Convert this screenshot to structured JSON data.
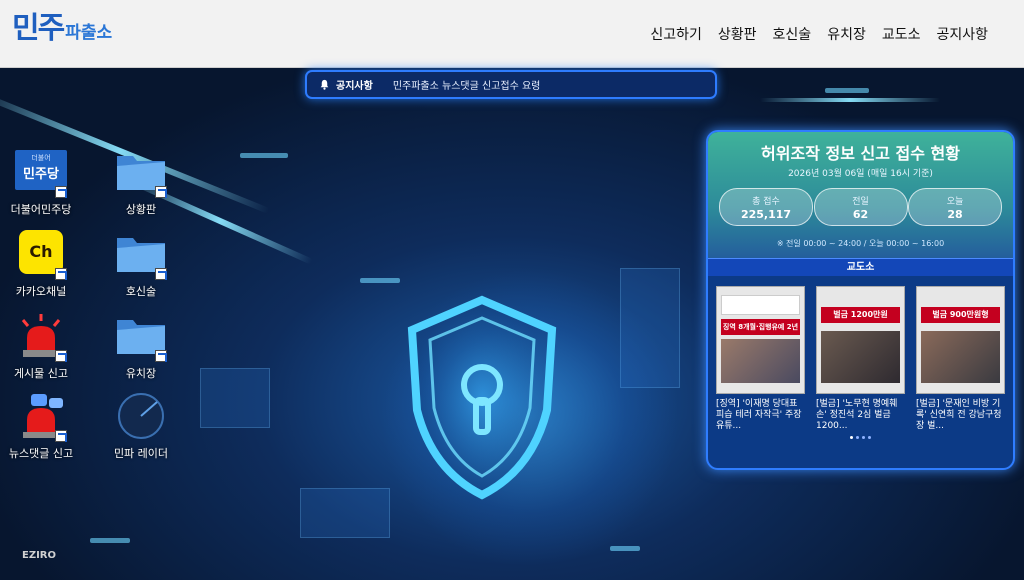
{
  "header": {
    "logo_main": "민주",
    "logo_sub": "파출소",
    "nav": [
      "신고하기",
      "상황판",
      "호신술",
      "유치장",
      "교도소",
      "공지사항"
    ]
  },
  "notice": {
    "label": "공지사항",
    "text": "민주파출소 뉴스댓글 신고접수 요령"
  },
  "desktop_icons": [
    {
      "label": "더불어민주당",
      "badge": "민주당",
      "badge_small": "더불어"
    },
    {
      "label": "상황판"
    },
    {
      "label": "카카오채널",
      "badge": "Ch"
    },
    {
      "label": "호신술"
    },
    {
      "label": "게시물 신고"
    },
    {
      "label": "유치장"
    },
    {
      "label": "뉴스댓글 신고"
    },
    {
      "label": "민파 레이더"
    }
  ],
  "widget": {
    "title": "허위조작 정보 신고 접수 현황",
    "date": "2026년 03월 06일 (매일 16시 기준)",
    "stats": [
      {
        "label": "총 접수",
        "value": "225,117"
      },
      {
        "label": "전일",
        "value": "62"
      },
      {
        "label": "오늘",
        "value": "28"
      }
    ],
    "footnote": "※ 전일 00:00 ~ 24:00 / 오늘 00:00 ~ 16:00",
    "section": "교도소",
    "cards": [
      {
        "headline": "징역 8개월·집행유예 2년",
        "caption": "[징역] '이재명 당대표 피습 테러 자작극' 주장 유튜..."
      },
      {
        "headline": "벌금 1200만원",
        "caption": "[벌금] '노무현 명예훼손' 정진석 2심 벌금 1200..."
      },
      {
        "headline": "벌금 900만원형",
        "caption": "[벌금] '문재인 비방 기록' 신연희 전 강남구청장 벌..."
      }
    ]
  },
  "footer": {
    "brand": "EZIRO"
  },
  "colors": {
    "accent": "#2f7dff",
    "logo": "#1f5fbf"
  }
}
